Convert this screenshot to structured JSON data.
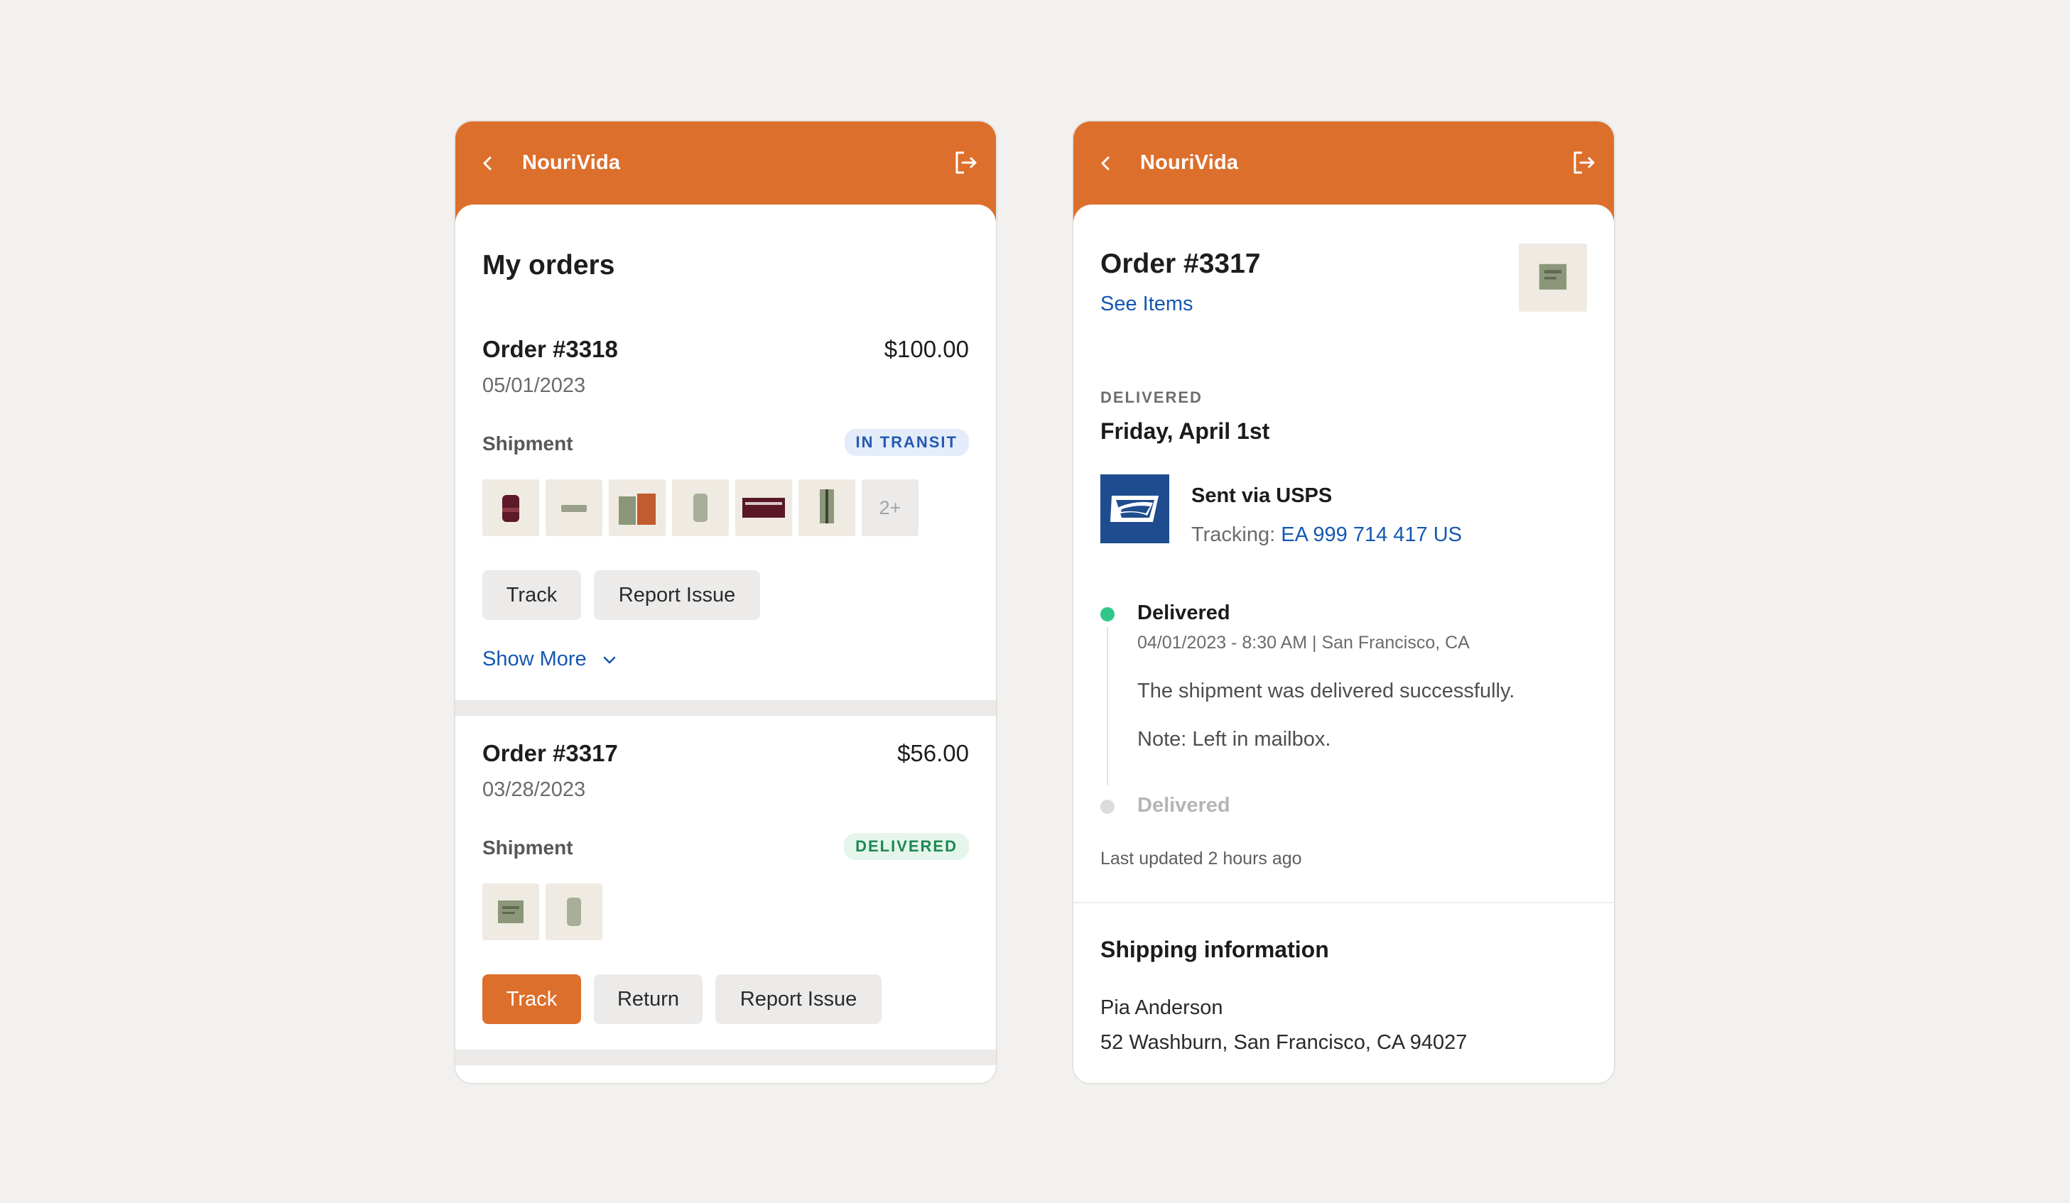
{
  "app": {
    "brand": "NouriVida"
  },
  "orders_screen": {
    "title": "My orders",
    "orders": [
      {
        "number": "Order #3318",
        "price": "$100.00",
        "date": "05/01/2023",
        "shipment_label": "Shipment",
        "status": "IN TRANSIT",
        "more_items": "2+",
        "buttons": {
          "track": "Track",
          "report": "Report Issue"
        },
        "show_more": "Show More"
      },
      {
        "number": "Order #3317",
        "price": "$56.00",
        "date": "03/28/2023",
        "shipment_label": "Shipment",
        "status": "DELIVERED",
        "buttons": {
          "track": "Track",
          "return": "Return",
          "report": "Report Issue"
        }
      }
    ]
  },
  "tracking_screen": {
    "title": "Order #3317",
    "see_items": "See Items",
    "status_caps": "DELIVERED",
    "delivery_date": "Friday, April 1st",
    "carrier": {
      "sent_via": "Sent via USPS",
      "tracking_label": "Tracking:",
      "tracking_number": "EA 999 714 417 US"
    },
    "timeline": [
      {
        "title": "Delivered",
        "meta": "04/01/2023 - 8:30 AM | San Francisco, CA",
        "detail": "The shipment was delivered successfully.",
        "note": "Note: Left in mailbox."
      },
      {
        "title": "Delivered"
      }
    ],
    "last_updated": "Last updated 2 hours ago",
    "shipping": {
      "heading": "Shipping information",
      "name": "Pia Anderson",
      "address": "52 Washburn, San Francisco, CA 94027"
    }
  },
  "colors": {
    "brand_orange": "#dd6f2c",
    "link_blue": "#1557b0",
    "delivered_green": "#2ec98a",
    "usps_blue": "#1e4c8f"
  }
}
